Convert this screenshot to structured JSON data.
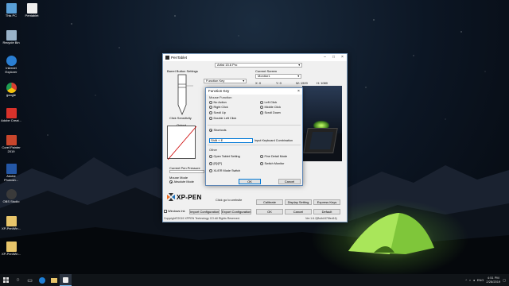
{
  "desktop": {
    "icons": [
      {
        "label": "This PC",
        "color": "#5aa0d8"
      },
      {
        "label": "Pentablet",
        "color": "#eeeeee"
      },
      {
        "label": "Recycle Bin",
        "color": "#9ab3c9"
      },
      {
        "label": "Internet Explorer",
        "color": "#2a7ed2"
      },
      {
        "label": "google",
        "color": "#e2b13c"
      },
      {
        "label": "Adobe Creat...",
        "color": "#d8322b"
      },
      {
        "label": "Corel Painter 2019",
        "color": "#c8462c"
      },
      {
        "label": "Adobe Photosh...",
        "color": "#2457a6"
      },
      {
        "label": "OBS Studio",
        "color": "#3a3a3a"
      },
      {
        "label": "XP-PenWin...",
        "color": "#e8c56a"
      },
      {
        "label": "XP-PenWin...",
        "color": "#e8c56a"
      }
    ]
  },
  "window": {
    "title": "PenTablet",
    "device_select": "Artist 15.6 Pro",
    "barrel_button_settings": "Barrel Button Settings",
    "barrel_function": "Function Key",
    "current_screen_label": "Current Screen",
    "monitor_select": "Monitor1",
    "x_label": "X: 0",
    "y_label": "Y: 0",
    "w_label": "W: 1920",
    "h_label": "H: 1080",
    "click_sensitivity": "Click Sensitivity",
    "output_label": "Output",
    "current_pen_pressure": "Current Pen Pressure",
    "mouse_mode_label": "Mouse Mode",
    "absolute_mode": "Absolute Mode",
    "brand": "XP-PEN",
    "click_website": "Click go to website",
    "buttons": {
      "calibrate": "Calibrate",
      "display_setting": "Display Setting",
      "express_keys": "Express Keys",
      "windows_ink": "Windows Ink",
      "import_config": "Import Configuration",
      "export_config": "Export Configuration",
      "ok": "OK",
      "cancel": "Cancel",
      "default": "Default"
    },
    "copyright": "Copyright©2019 XPPEN Technology CO.All Rights Reserved.",
    "version": "Ver:1.6.2(Build:875fed16)"
  },
  "dialog": {
    "title": "Function Key",
    "mouse_function": "Mouse Function",
    "options_left": [
      "No Action",
      "Right Click",
      "Scroll Up",
      "Double Left Click"
    ],
    "options_right": [
      "Left Click",
      "Middle Click",
      "Scroll Down"
    ],
    "shortcuts_label": "Shortcuts",
    "shortcut_value": "Shift + E",
    "input_hint": "Input Keyboard Combination",
    "other_label": "Other",
    "other_left": [
      "Open Tablet Setting",
      "[E]/[P]",
      "XL/ER Mode Switch"
    ],
    "other_right": [
      "Fine Detail Mode",
      "Switch Monitor"
    ],
    "ok": "OK",
    "cancel": "Cancel"
  },
  "taskbar": {
    "language": "ENG",
    "time": "4:51 PM",
    "date": "2/28/2019"
  },
  "colors": {
    "accent": "#0078d7",
    "tent_green": "#a6e850"
  }
}
